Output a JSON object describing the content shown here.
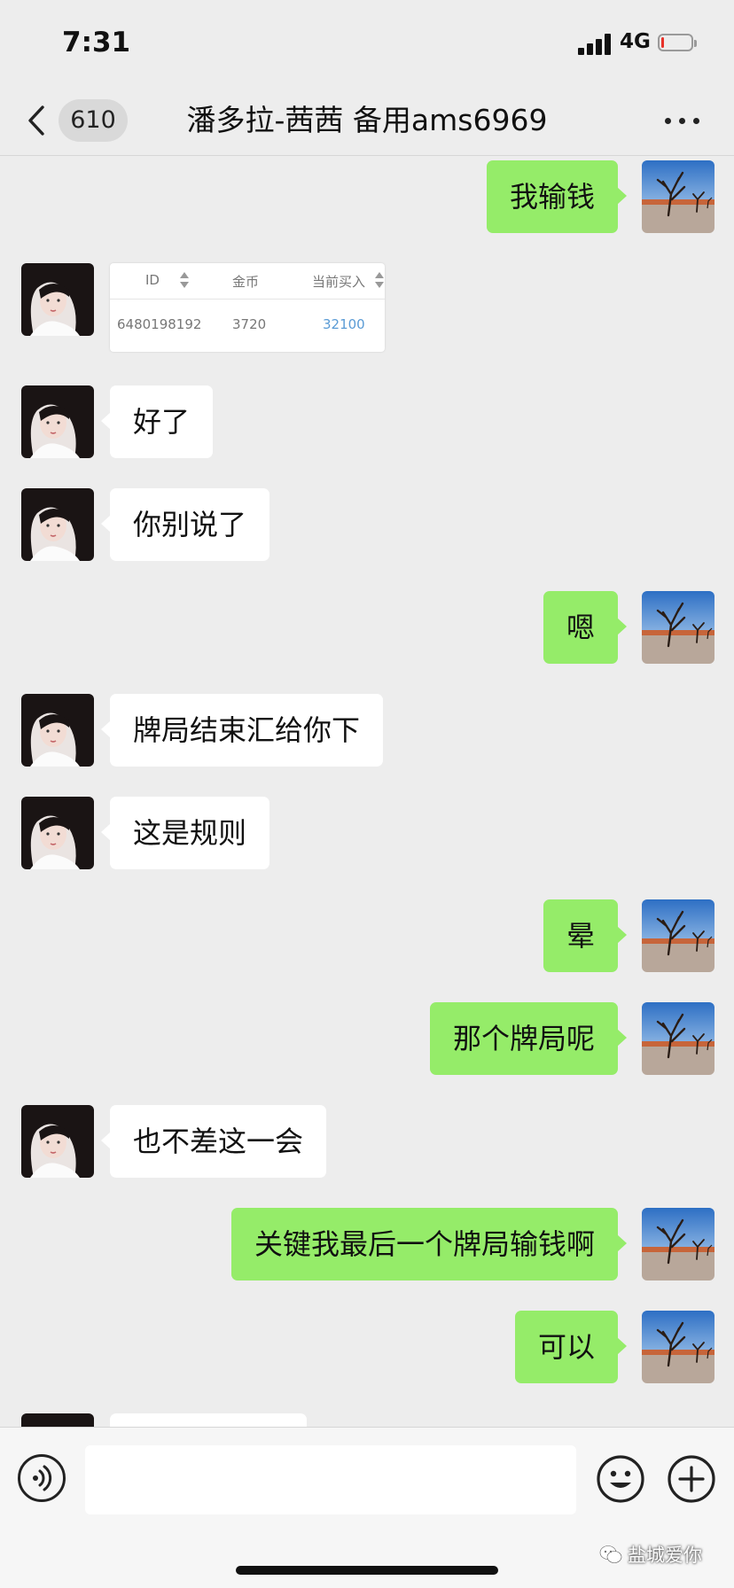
{
  "status_bar": {
    "time": "7:31",
    "network": "4G",
    "battery_level": 0.1,
    "colors": {
      "battery_low": "#e8322a"
    }
  },
  "nav": {
    "unread_count": "610",
    "title": "潘多拉-茜茜 备用ams6969"
  },
  "chat": {
    "colors": {
      "outgoing_bubble": "#95ec69",
      "incoming_bubble": "#ffffff",
      "background": "#ededed"
    },
    "messages": [
      {
        "side": "out",
        "text": "我输钱"
      },
      {
        "side": "in",
        "type": "image-table",
        "table": {
          "headers": [
            "ID",
            "金币",
            "当前买入"
          ],
          "rows": [
            [
              "6480198192",
              "3720",
              "32100"
            ]
          ]
        }
      },
      {
        "side": "in",
        "text": "好了"
      },
      {
        "side": "in",
        "text": "你别说了"
      },
      {
        "side": "out",
        "text": "嗯"
      },
      {
        "side": "in",
        "text": "牌局结束汇给你下"
      },
      {
        "side": "in",
        "text": "这是规则"
      },
      {
        "side": "out",
        "text": "晕"
      },
      {
        "side": "out",
        "text": "那个牌局呢"
      },
      {
        "side": "in",
        "text": "也不差这一会"
      },
      {
        "side": "out",
        "text": "关键我最后一个牌局输钱啊"
      },
      {
        "side": "out",
        "text": "可以"
      },
      {
        "side": "in",
        "text": ""
      }
    ]
  },
  "input_bar": {
    "value": "",
    "placeholder": "",
    "icons": [
      "voice-icon",
      "emoji-icon",
      "plus-icon"
    ]
  },
  "watermark": {
    "text": "盐城爱你"
  }
}
